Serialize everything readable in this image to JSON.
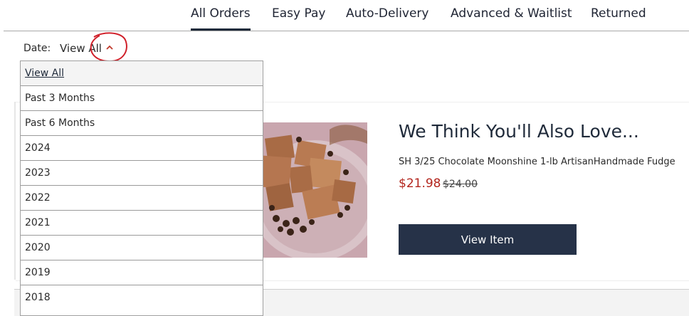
{
  "tabs": {
    "all_orders": "All Orders",
    "easy_pay": "Easy Pay",
    "auto_delivery": "Auto-Delivery",
    "advanced_waitlist": "Advanced & Waitlist",
    "returned": "Returned",
    "active": "All Orders"
  },
  "filter": {
    "label": "Date:",
    "selected": "View All",
    "chevron_icon": "chevron-up-icon"
  },
  "dropdown": {
    "options": [
      "View All",
      "Past 3 Months",
      "Past 6 Months",
      "2024",
      "2023",
      "2022",
      "2021",
      "2020",
      "2019",
      "2018"
    ]
  },
  "promo": {
    "heading": "We Think You'll Also Love...",
    "product_name": "SH 3/25 Chocolate Moonshine 1-lb ArtisanHandmade Fudge",
    "price_sale": "$21.98",
    "price_original": "$24.00",
    "button_label": "View Item"
  },
  "colors": {
    "accent_dark": "#263248",
    "sale_red": "#b3261e",
    "annotation_red": "#d0202a"
  }
}
